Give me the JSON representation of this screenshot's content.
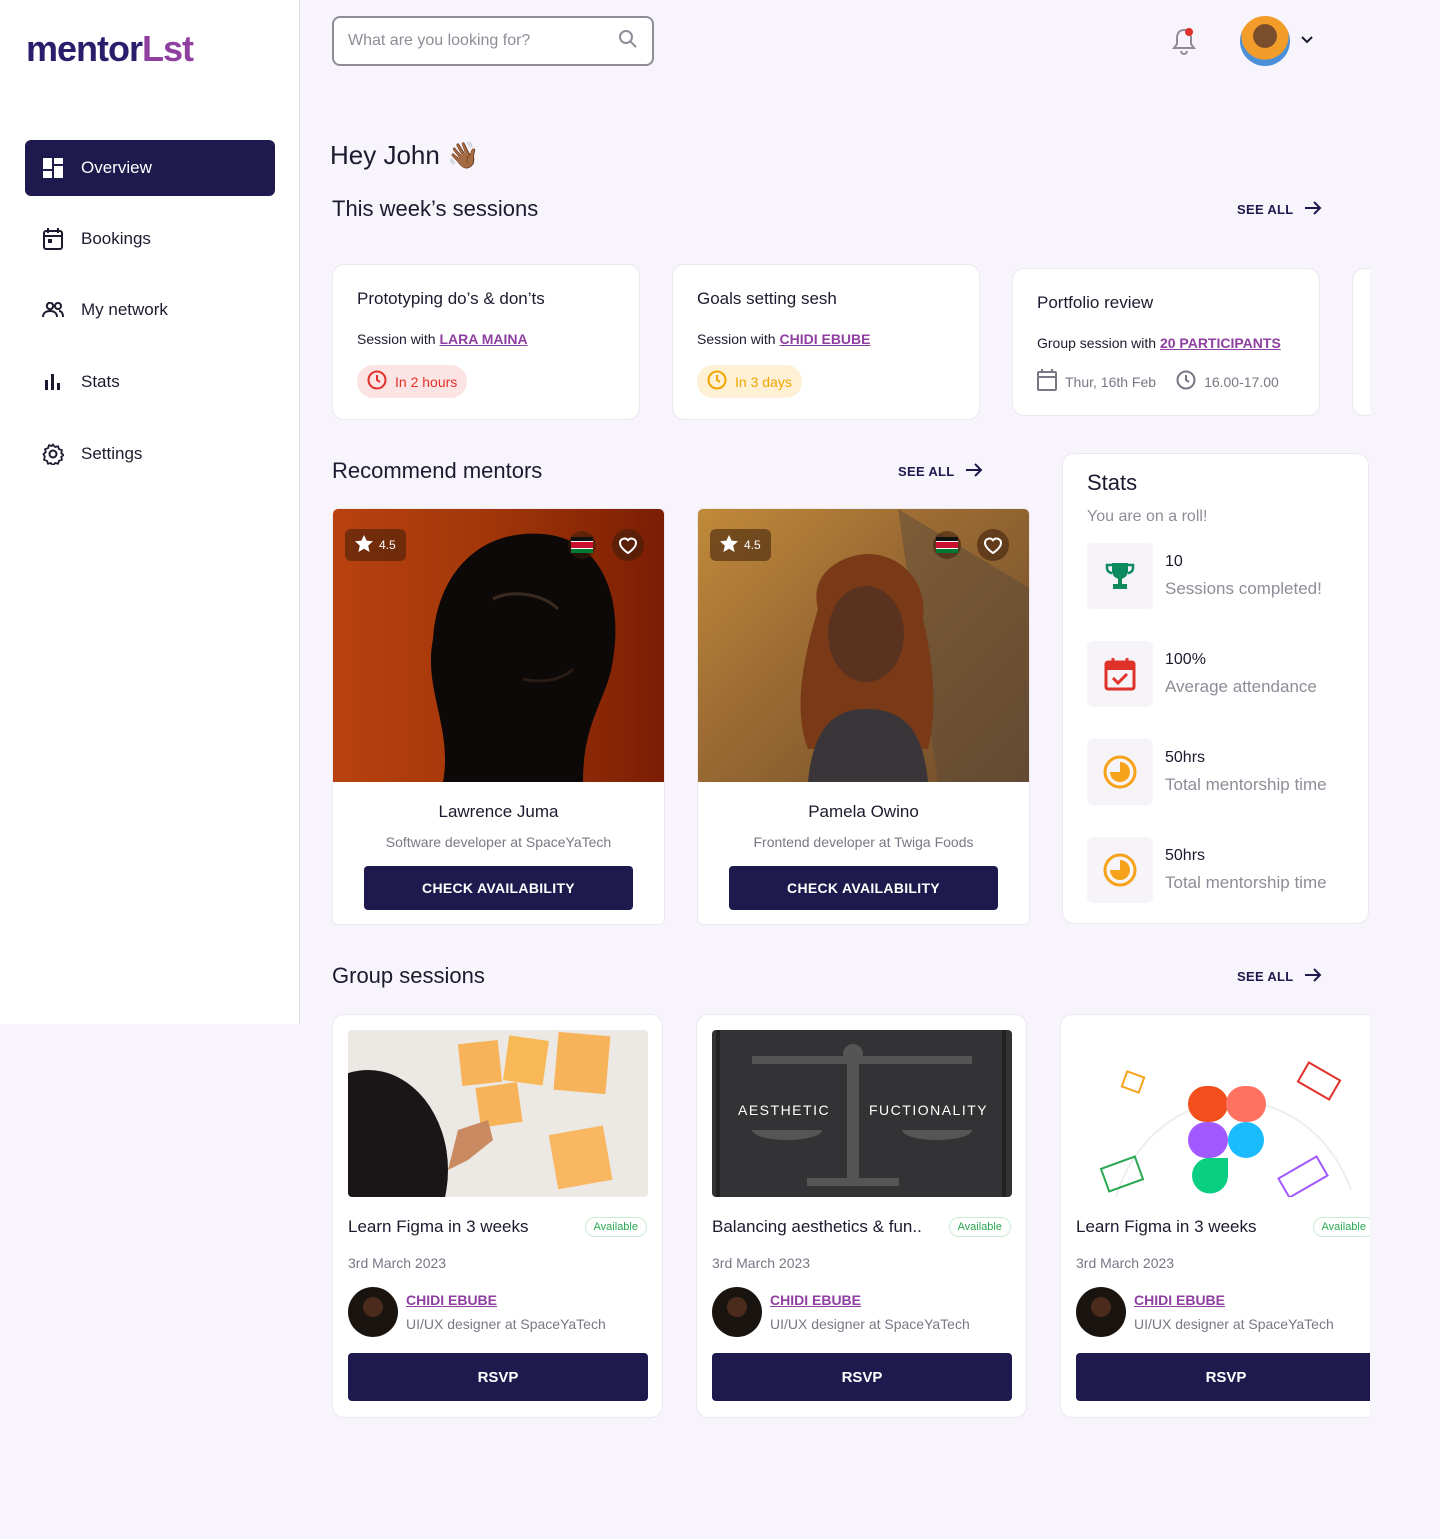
{
  "logo": {
    "part1": "mentor",
    "part2": "Lst"
  },
  "sidebar": {
    "items": [
      {
        "label": "Overview"
      },
      {
        "label": "Bookings"
      },
      {
        "label": "My network"
      },
      {
        "label": "Stats"
      },
      {
        "label": "Settings"
      }
    ]
  },
  "search": {
    "placeholder": "What are you looking for?"
  },
  "greeting": "Hey John 👋🏾",
  "weekly": {
    "title": "This week’s sessions",
    "see_all": "SEE ALL",
    "cards": [
      {
        "title": "Prototyping do’s & don’ts",
        "with_prefix": "Session with",
        "with": "LARA MAINA",
        "status": "In 2 hours"
      },
      {
        "title": "Goals setting sesh",
        "with_prefix": "Session with",
        "with": "CHIDI EBUBE",
        "status": "In 3 days"
      },
      {
        "title": "Portfolio review",
        "with_prefix": "Group session with",
        "with": "20 PARTICIPANTS",
        "date": "Thur, 16th Feb",
        "time": "16.00-17.00"
      }
    ]
  },
  "mentors": {
    "title": "Recommend mentors",
    "see_all": "SEE ALL",
    "cards": [
      {
        "rating": "4.5",
        "name": "Lawrence Juma",
        "role": "Software developer at SpaceYaTech",
        "button": "CHECK AVAILABILITY"
      },
      {
        "rating": "4.5",
        "name": "Pamela Owino",
        "role": "Frontend developer at Twiga Foods",
        "button": "CHECK AVAILABILITY"
      }
    ]
  },
  "stats": {
    "title": "Stats",
    "subtitle": "You are on a roll!",
    "items": [
      {
        "value": "10",
        "label": "Sessions completed!"
      },
      {
        "value": "100%",
        "label": "Average attendance"
      },
      {
        "value": "50hrs",
        "label": "Total mentorship time"
      },
      {
        "value": "50hrs",
        "label": "Total mentorship time"
      }
    ]
  },
  "groups": {
    "title": "Group sessions",
    "see_all": "SEE ALL",
    "cards": [
      {
        "title": "Learn Figma in 3 weeks",
        "badge": "Available",
        "date": "3rd March 2023",
        "host": "CHIDI EBUBE",
        "host_role": "UI/UX designer at SpaceYaTech",
        "button": "RSVP"
      },
      {
        "title": "Balancing aesthetics & fun..",
        "badge": "Available",
        "date": "3rd March 2023",
        "host": "CHIDI EBUBE",
        "host_role": "UI/UX designer at SpaceYaTech",
        "button": "RSVP",
        "image_text_left": "AESTHETIC",
        "image_text_right": "FUCTIONALITY"
      },
      {
        "title": "Learn Figma in 3 weeks",
        "badge": "Available",
        "date": "3rd March 2023",
        "host": "CHIDI EBUBE",
        "host_role": "UI/UX designer at SpaceYaTech",
        "button": "RSVP"
      }
    ]
  },
  "colors": {
    "primary": "#1e1a4d",
    "accent": "#8e3fa0",
    "danger": "#e0312b",
    "warning": "#f0a500",
    "success": "#2aa852"
  }
}
